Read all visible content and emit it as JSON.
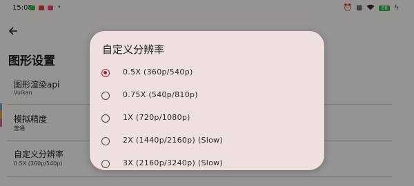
{
  "status_bar": {
    "time": "15:08",
    "notification_icons": [
      "app-notification-green",
      "app-notification-red",
      "app-notification-pink"
    ],
    "more_indicator": "•",
    "system_icons": [
      "alarm-icon",
      "nfc-icon",
      "wifi-icon",
      "battery-icon"
    ],
    "battery_level": "88"
  },
  "page": {
    "title": "图形设置",
    "settings": [
      {
        "title": "图形渲染api",
        "subtitle": "Vulkan"
      },
      {
        "title": "模拟精度",
        "subtitle": "普通"
      },
      {
        "title": "自定义分辨率",
        "subtitle": "0.5X (360p/540p)"
      }
    ]
  },
  "dialog": {
    "title": "自定义分辨率",
    "options": [
      {
        "label": "0.5X (360p/540p)",
        "selected": true
      },
      {
        "label": "0.75X (540p/810p)",
        "selected": false
      },
      {
        "label": "1X (720p/1080p)",
        "selected": false
      },
      {
        "label": "2X (1440p/2160p) (Slow)",
        "selected": false
      },
      {
        "label": "3X (2160p/3240p) (Slow)",
        "selected": false
      }
    ]
  },
  "colors": {
    "accent": "#a8232a",
    "dialog_bg": "#efe0e0",
    "page_bg": "#fbf6f6"
  }
}
